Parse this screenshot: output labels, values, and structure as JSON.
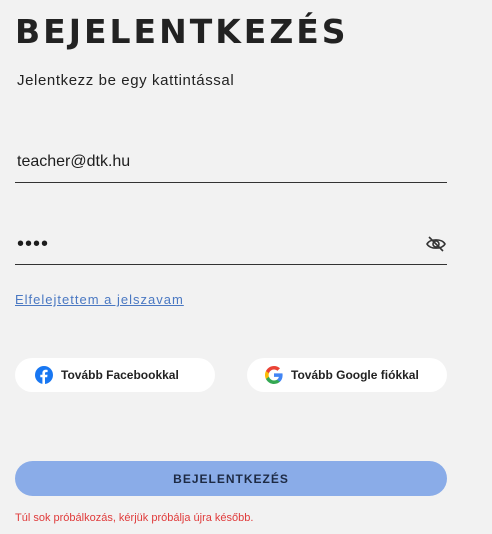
{
  "header": {
    "title": "BEJELENTKEZÉS",
    "subtitle": "Jelentkezz be egy kattintással"
  },
  "form": {
    "email_value": "teacher@dtk.hu",
    "password_value": "1234",
    "forgot_link": "Elfelejtettem a jelszavam"
  },
  "social": {
    "facebook_label": "Tovább Facebookkal",
    "google_label": "Tovább Google fiókkal"
  },
  "submit": {
    "label": "BEJELENTKEZÉS"
  },
  "error": {
    "message": "Túl sok próbálkozás, kérjük próbálja újra később."
  },
  "icons": {
    "password_toggle": "eye-slash-icon",
    "facebook": "facebook-icon",
    "google": "google-icon"
  },
  "colors": {
    "background": "#f2f2f2",
    "primary_button": "#8aace8",
    "link": "#4a78c2",
    "error": "#e03b3b",
    "facebook": "#1877f2"
  }
}
